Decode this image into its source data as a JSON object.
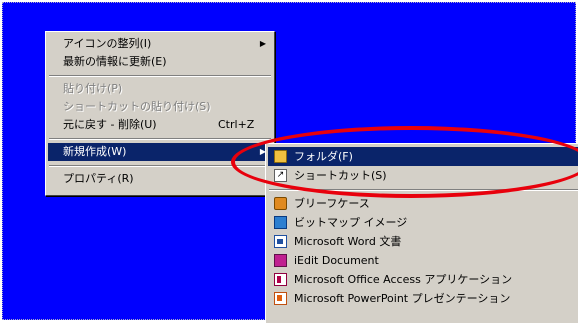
{
  "context_menu": {
    "items": [
      {
        "label": "アイコンの整列(I)",
        "has_submenu": true
      },
      {
        "label": "最新の情報に更新(E)"
      },
      {
        "label": "貼り付け(P)",
        "disabled": true
      },
      {
        "label": "ショートカットの貼り付け(S)",
        "disabled": true
      },
      {
        "label": "元に戻す - 削除(U)",
        "shortcut": "Ctrl+Z"
      },
      {
        "label": "新規作成(W)",
        "has_submenu": true,
        "selected": true
      },
      {
        "label": "プロパティ(R)"
      }
    ]
  },
  "new_submenu": {
    "items": [
      {
        "label": "フォルダ(F)",
        "icon": "folder-icon",
        "selected": true
      },
      {
        "label": "ショートカット(S)",
        "icon": "shortcut-icon"
      },
      {
        "label": "ブリーフケース",
        "icon": "briefcase-icon"
      },
      {
        "label": "ビットマップ イメージ",
        "icon": "bitmap-image-icon"
      },
      {
        "label": "Microsoft Word 文書",
        "icon": "word-document-icon"
      },
      {
        "label": "iEdit Document",
        "icon": "iedit-document-icon"
      },
      {
        "label": "Microsoft Office Access アプリケーション",
        "icon": "access-application-icon"
      },
      {
        "label": "Microsoft PowerPoint プレゼンテーション",
        "icon": "powerpoint-presentation-icon"
      }
    ]
  },
  "colors": {
    "desktop": "#0000ff",
    "menu_face": "#d4d0c8",
    "selection": "#0a246a",
    "highlight_ellipse": "#e8000c"
  }
}
